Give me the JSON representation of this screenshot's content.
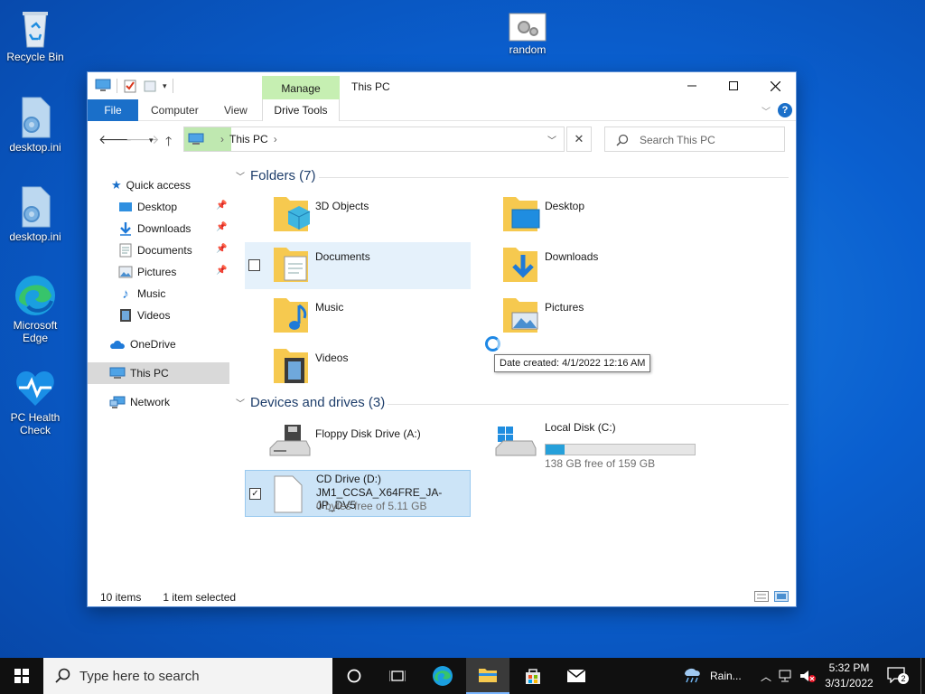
{
  "desktop": {
    "icons": [
      {
        "label": "Recycle Bin"
      },
      {
        "label": "desktop.ini"
      },
      {
        "label": "desktop.ini"
      },
      {
        "label": "Microsoft Edge"
      },
      {
        "label": "PC Health Check"
      },
      {
        "label": "random"
      }
    ]
  },
  "window": {
    "title": "This PC",
    "manage_tab": "Manage",
    "ribbon_tabs": {
      "file": "File",
      "computer": "Computer",
      "view": "View",
      "drive_tools": "Drive Tools"
    },
    "address": {
      "segment": "This PC",
      "clear": "✕"
    },
    "search": {
      "placeholder": "Search This PC"
    },
    "sidebar": {
      "quick_access": "Quick access",
      "items": [
        "Desktop",
        "Downloads",
        "Documents",
        "Pictures",
        "Music",
        "Videos"
      ],
      "onedrive": "OneDrive",
      "this_pc": "This PC",
      "network": "Network"
    },
    "folders_header": "Folders (7)",
    "folders": [
      "3D Objects",
      "Desktop",
      "Documents",
      "Downloads",
      "Music",
      "Pictures",
      "Videos"
    ],
    "drives_header": "Devices and drives (3)",
    "drives": {
      "floppy": {
        "name": "Floppy Disk Drive (A:)"
      },
      "local": {
        "name": "Local Disk (C:)",
        "free": "138 GB free of 159 GB",
        "used_fraction": 0.13
      },
      "cd": {
        "name": "CD Drive (D:)",
        "label": "JM1_CCSA_X64FRE_JA-JP_DV5",
        "free": "0 bytes free of 5.11 GB"
      }
    },
    "tooltip": "Date created: 4/1/2022 12:16 AM",
    "status": {
      "items": "10 items",
      "selected": "1 item selected"
    }
  },
  "taskbar": {
    "search_placeholder": "Type here to search",
    "weather": "Rain...",
    "time": "5:32 PM",
    "date": "3/31/2022",
    "notifications": "2"
  },
  "colors": {
    "accent": "#1a6fc9",
    "manage_green": "#c6efb2",
    "selection": "#cce4f7",
    "disk_bar": "#26a0da"
  }
}
